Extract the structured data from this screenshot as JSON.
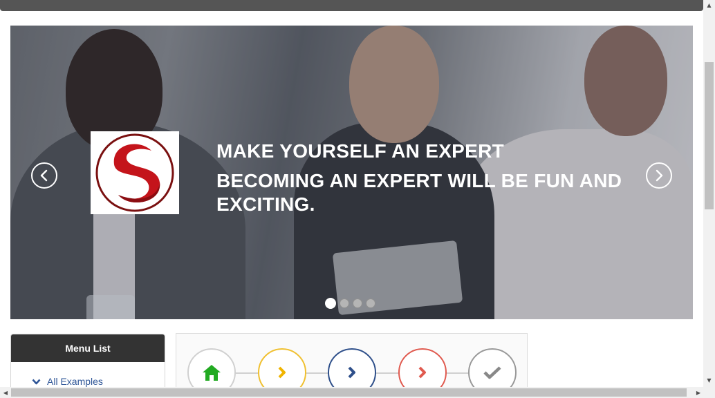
{
  "hero": {
    "headline_line1": "MAKE YOURSELF AN EXPERT",
    "headline_line2": "BECOMING AN EXPERT WILL BE FUN AND EXCITING.",
    "slide_count": 4,
    "active_slide": 1
  },
  "menu": {
    "title": "Menu List",
    "items": [
      {
        "label": "All Examples",
        "icon": "chevron-down-icon"
      }
    ]
  },
  "steps": [
    {
      "icon": "home-icon",
      "color": "#22aa22"
    },
    {
      "icon": "chevron-right-icon",
      "color": "#f0b400"
    },
    {
      "icon": "chevron-right-icon",
      "color": "#2e4f8a"
    },
    {
      "icon": "chevron-right-icon",
      "color": "#e05a4f"
    },
    {
      "icon": "check-icon",
      "color": "#888888"
    }
  ],
  "colors": {
    "topbar": "#555555",
    "menu_header": "#333333",
    "link": "#2e5597",
    "logo_red": "#c4141b"
  }
}
